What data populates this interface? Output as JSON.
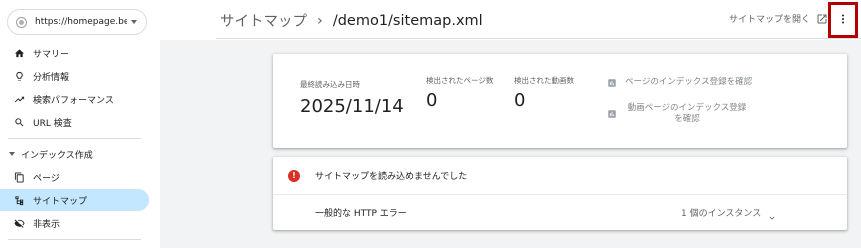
{
  "property": {
    "url": "https://homepage.beppu-"
  },
  "sidebar": {
    "items": [
      {
        "label": "サマリー",
        "icon": "home-icon"
      },
      {
        "label": "分析情報",
        "icon": "lightbulb-icon"
      },
      {
        "label": "検索パフォーマンス",
        "icon": "trending-up-icon"
      },
      {
        "label": "URL 検査",
        "icon": "search-icon"
      }
    ],
    "section": {
      "label": "インデックス作成"
    },
    "section_items": [
      {
        "label": "ページ",
        "icon": "pages-icon"
      },
      {
        "label": "サイトマップ",
        "icon": "sitemap-icon",
        "active": true
      },
      {
        "label": "非表示",
        "icon": "eye-off-icon"
      }
    ]
  },
  "header": {
    "breadcrumb_root": "サイトマップ",
    "breadcrumb_sep": "›",
    "breadcrumb_current": "/demo1/sitemap.xml",
    "open_label": "サイトマップを開く"
  },
  "stats": {
    "last_read_label": "最終読み込み日時",
    "last_read_value": "2025/11/14",
    "pages_label": "検出されたページ数",
    "pages_value": "0",
    "videos_label": "検出された動画数",
    "videos_value": "0",
    "check_pages_label": "ページのインデックス登録を確認",
    "check_videos_label": "動画ページのインデックス登録を確認"
  },
  "error": {
    "title": "サイトマップを読み込めませんでした",
    "detail_name": "一般的な HTTP エラー",
    "detail_count": "1 個のインスタンス"
  },
  "colors": {
    "active_bg": "#c2e7ff",
    "error": "#d93025",
    "highlight_border": "#b30000"
  }
}
